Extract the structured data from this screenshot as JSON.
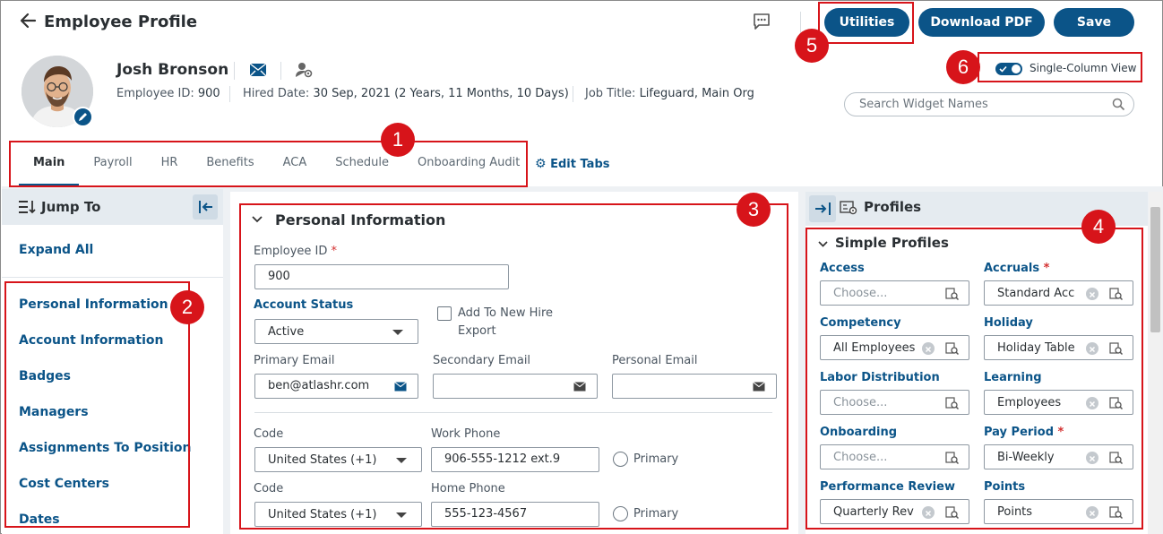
{
  "header": {
    "title": "Employee Profile",
    "buttons": {
      "utilities": "Utilities",
      "download_pdf": "Download PDF",
      "save": "Save"
    }
  },
  "employee": {
    "name": "Josh Bronson",
    "id_label": "Employee ID:",
    "id_value": "900",
    "hired_label": "Hired Date:",
    "hired_value": "30 Sep, 2021 (2 Years, 11 Months, 10 Days)",
    "job_label": "Job Title:",
    "job_value": "Lifeguard, Main Org"
  },
  "view_toggle": {
    "label": "Single-Column View",
    "on": true
  },
  "search": {
    "placeholder": "Search Widget Names"
  },
  "tabs": [
    "Main",
    "Payroll",
    "HR",
    "Benefits",
    "ACA",
    "Schedule",
    "Onboarding Audit"
  ],
  "active_tab": "Main",
  "edit_tabs": "Edit Tabs",
  "jump_to": {
    "title": "Jump To",
    "expand_all": "Expand All",
    "items": [
      "Personal Information",
      "Account Information",
      "Badges",
      "Managers",
      "Assignments To Position",
      "Cost Centers",
      "Dates"
    ]
  },
  "personal_info": {
    "title": "Personal Information",
    "employee_id_label": "Employee ID",
    "employee_id_value": "900",
    "account_status_label": "Account Status",
    "account_status_value": "Active",
    "add_new_hire_line1": "Add To New Hire",
    "add_new_hire_line2": "Export",
    "primary_email_label": "Primary Email",
    "primary_email_value": "ben@atlashr.com",
    "secondary_email_label": "Secondary Email",
    "personal_email_label": "Personal Email",
    "code_label": "Code",
    "work_code_value": "United States (+1)",
    "work_phone_label": "Work Phone",
    "work_phone_value": "906-555-1212 ext.9",
    "home_code_value": "United States (+1)",
    "home_phone_label": "Home Phone",
    "home_phone_value": "555-123-4567",
    "primary_label": "Primary"
  },
  "profiles": {
    "title": "Profiles",
    "section": "Simple Profiles",
    "items": [
      {
        "label": "Access",
        "value": "Choose...",
        "required": false,
        "placeholder": true
      },
      {
        "label": "Accruals",
        "value": "Standard Acc",
        "required": true,
        "placeholder": false
      },
      {
        "label": "Competency",
        "value": "All Employees",
        "required": false,
        "placeholder": false
      },
      {
        "label": "Holiday",
        "value": "Holiday Table",
        "required": false,
        "placeholder": false
      },
      {
        "label": "Labor Distribution",
        "value": "Choose...",
        "required": false,
        "placeholder": true
      },
      {
        "label": "Learning",
        "value": "Employees",
        "required": false,
        "placeholder": false
      },
      {
        "label": "Onboarding",
        "value": "Choose...",
        "required": false,
        "placeholder": true
      },
      {
        "label": "Pay Period",
        "value": "Bi-Weekly",
        "required": true,
        "placeholder": false
      },
      {
        "label": "Performance Review",
        "value": "Quarterly Rev",
        "required": false,
        "placeholder": false
      },
      {
        "label": "Points",
        "value": "Points",
        "required": false,
        "placeholder": false
      }
    ]
  },
  "required_mark": "*",
  "callouts": [
    "1",
    "2",
    "3",
    "4",
    "5",
    "6"
  ],
  "colors": {
    "brand": "#0b5488",
    "callout": "#d7141a"
  }
}
